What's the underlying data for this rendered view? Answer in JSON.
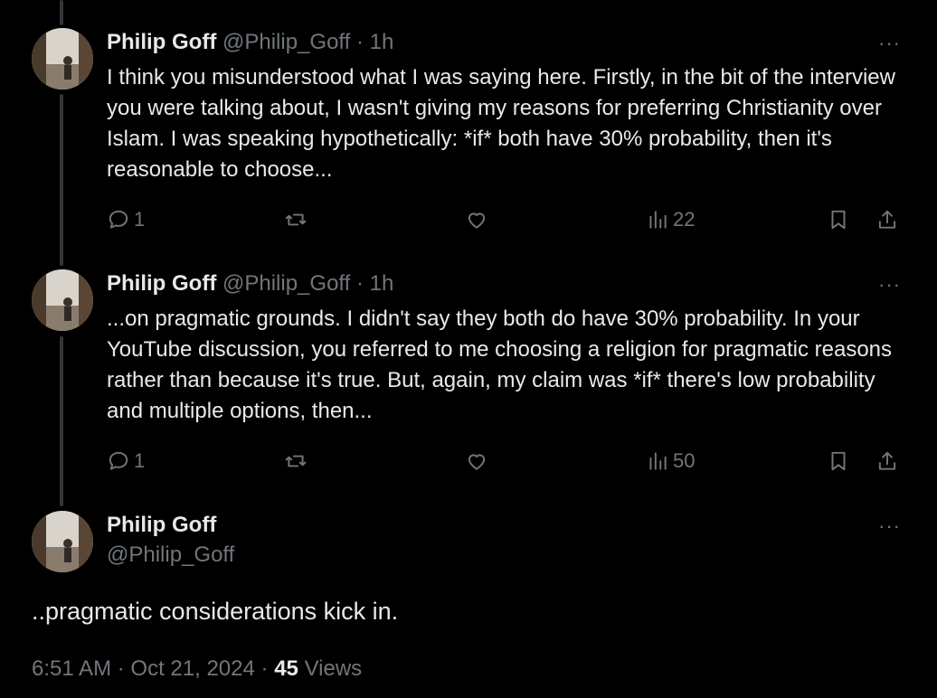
{
  "colors": {
    "background": "#000000",
    "text_primary": "#e7e9ea",
    "text_secondary": "#71767b",
    "thread_line": "#333639"
  },
  "tweets": [
    {
      "author_name": "Philip Goff",
      "handle": "@Philip_Goff",
      "separator": "·",
      "time": "1h",
      "text": "I think you misunderstood what I was saying here. Firstly, in the bit of the interview you were talking about, I wasn't giving my reasons for preferring Christianity over Islam. I was speaking hypothetically: *if* both have 30% probability, then it's reasonable to choose...",
      "replies": "1",
      "views": "22"
    },
    {
      "author_name": "Philip Goff",
      "handle": "@Philip_Goff",
      "separator": "·",
      "time": "1h",
      "text": "...on pragmatic grounds. I didn't say they both do have 30% probability. In your YouTube discussion, you referred to me choosing a religion for pragmatic reasons rather than because it's true. But, again, my claim was *if* there's low probability and multiple options, then...",
      "replies": "1",
      "views": "50"
    }
  ],
  "main_tweet": {
    "author_name": "Philip Goff",
    "handle": "@Philip_Goff",
    "text": "..pragmatic considerations kick in.",
    "time": "6:51 AM",
    "date": "Oct 21, 2024",
    "separator": "·",
    "views_count": "45",
    "views_label": "Views"
  },
  "icons": {
    "reply": "speech-bubble-icon",
    "retweet": "retweet-arrows-icon",
    "like": "heart-icon",
    "views": "bar-chart-icon",
    "bookmark": "bookmark-icon",
    "share": "share-upload-icon",
    "more": "more-dots-icon"
  },
  "more_glyph": "···"
}
